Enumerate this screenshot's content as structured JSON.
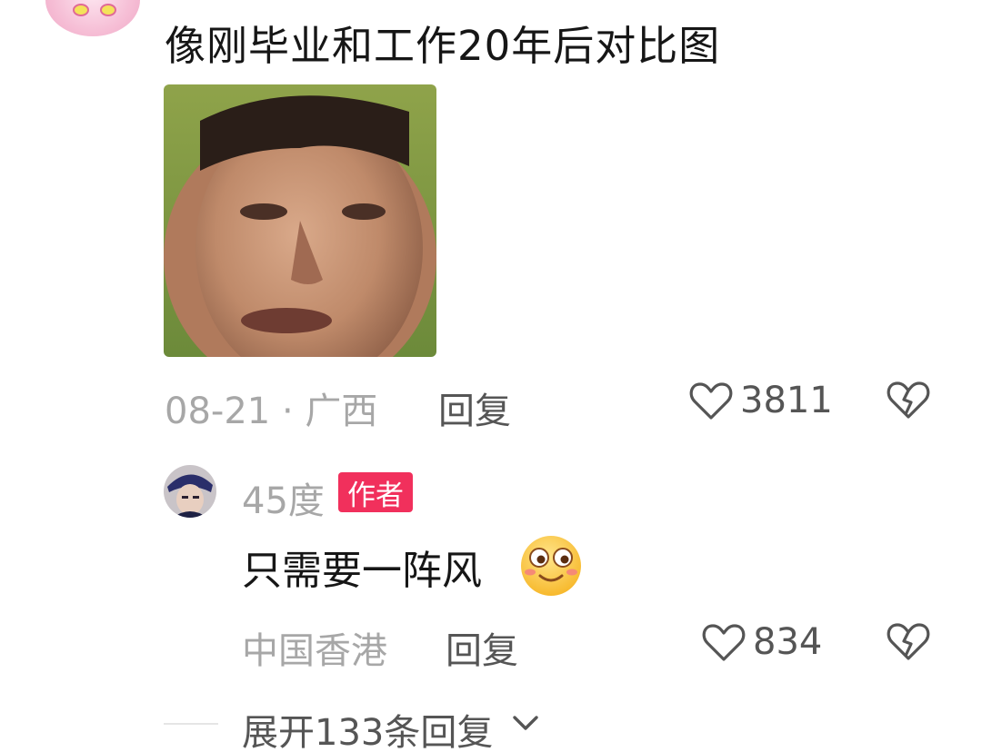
{
  "comment": {
    "text": "像刚毕业和工作20年后对比图",
    "date": "08-21",
    "separator": "·",
    "location": "广西",
    "reply_label": "回复",
    "likes": "3811"
  },
  "reply": {
    "author": "45度",
    "badge": "作者",
    "text": "只需要一阵风",
    "location": "中国香港",
    "reply_label": "回复",
    "likes": "834"
  },
  "expand": {
    "label": "展开133条回复"
  },
  "icons": {
    "like": "heart-outline-icon",
    "dislike": "broken-heart-icon",
    "expand": "chevron-down-icon",
    "emoji": "smiley-emoji"
  },
  "colors": {
    "badge": "#f1305c",
    "muted": "#a7a7a7",
    "text": "#161616"
  }
}
